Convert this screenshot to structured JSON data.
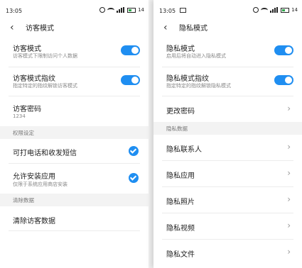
{
  "left": {
    "status": {
      "time": "13:05",
      "battery": "14"
    },
    "title": "访客模式",
    "rows": [
      {
        "label": "访客模式",
        "sub": "访客模式下限制访问个人数据"
      },
      {
        "label": "访客模式指纹",
        "sub": "指定特定的指纹解锁访客模式"
      },
      {
        "label": "访客密码",
        "sub": "1234"
      }
    ],
    "section1": "权限设定",
    "perm_rows": [
      {
        "label": "可打电话和收发短信"
      },
      {
        "label": "允许安装应用",
        "sub": "仅限于系统应用商店安装"
      }
    ],
    "section2": "清除数据",
    "clear_label": "清除访客数据"
  },
  "right": {
    "status": {
      "time": "13:05",
      "battery": "14"
    },
    "title": "隐私模式",
    "rows": [
      {
        "label": "隐私模式",
        "sub": "启用后将自动进入隐私模式"
      },
      {
        "label": "隐私模式指纹",
        "sub": "指定特定的指纹解锁隐私模式"
      },
      {
        "label": "更改密码"
      }
    ],
    "section": "隐私数据",
    "data_rows": [
      {
        "label": "隐私联系人"
      },
      {
        "label": "隐私应用"
      },
      {
        "label": "隐私照片"
      },
      {
        "label": "隐私视频"
      },
      {
        "label": "隐私文件"
      }
    ]
  },
  "colors": {
    "accent": "#1f8ef1",
    "section_bg": "#f3f3f3"
  }
}
